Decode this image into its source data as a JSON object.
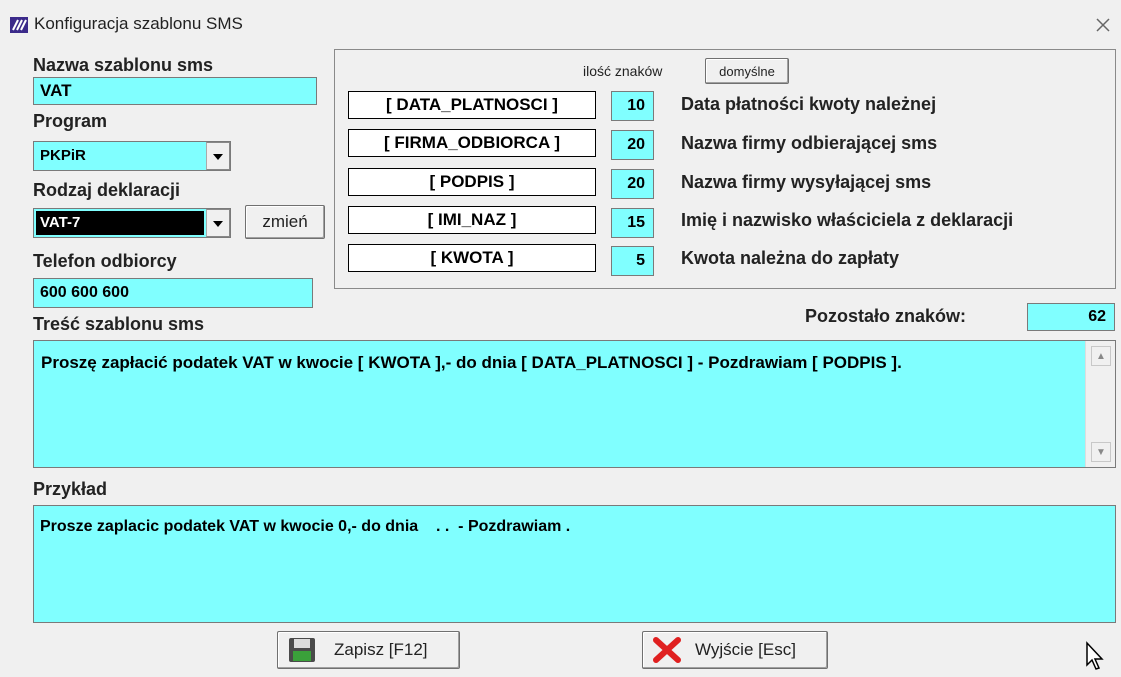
{
  "window": {
    "title": "Konfiguracja szablonu SMS"
  },
  "fields": {
    "template_name_label": "Nazwa szablonu sms",
    "template_name_value": "VAT",
    "program_label": "Program",
    "program_value": "PKPiR",
    "declaration_label": "Rodzaj deklaracji",
    "declaration_value": "VAT-7",
    "change_button": "zmień",
    "phone_label": "Telefon odbiorcy",
    "phone_value": "600 600 600",
    "content_label": "Treść szablonu sms"
  },
  "chars_panel": {
    "header_label": "ilość znaków",
    "default_button": "domyślne",
    "rows": [
      {
        "tag": "[ DATA_PLATNOSCI ]",
        "count": "10",
        "desc": "Data płatności kwoty należnej"
      },
      {
        "tag": "[ FIRMA_ODBIORCA ]",
        "count": "20",
        "desc": "Nazwa firmy odbierającej sms"
      },
      {
        "tag": "[ PODPIS ]",
        "count": "20",
        "desc": "Nazwa firmy wysyłającej sms"
      },
      {
        "tag": "[ IMI_NAZ ]",
        "count": "15",
        "desc": "Imię i nazwisko właściciela z deklaracji"
      },
      {
        "tag": "[ KWOTA ]",
        "count": "5",
        "desc": "Kwota należna do zapłaty"
      }
    ]
  },
  "remaining": {
    "label": "Pozostało znaków:",
    "value": "62"
  },
  "content": {
    "text": "Proszę zapłacić podatek VAT w kwocie [ KWOTA ],- do dnia [ DATA_PLATNOSCI ] - Pozdrawiam [ PODPIS ]."
  },
  "example": {
    "label": "Przykład",
    "text": "Prosze zaplacic podatek VAT w kwocie 0,- do dnia    . .  - Pozdrawiam ."
  },
  "buttons": {
    "save": "Zapisz  [F12]",
    "exit": "Wyjście  [Esc]"
  },
  "colors": {
    "field_bg": "#80ffff",
    "selected_bg": "#000000",
    "save_icon": "#3a8a3a",
    "exit_icon": "#e02020"
  }
}
